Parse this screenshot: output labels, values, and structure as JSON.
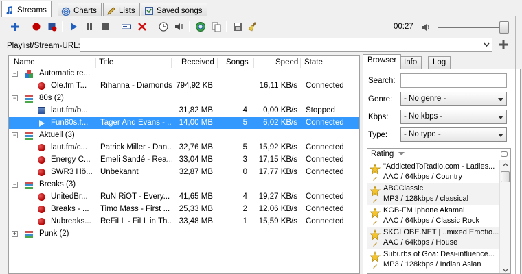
{
  "tabs": [
    {
      "label": "Streams",
      "icon": "note-icon"
    },
    {
      "label": "Charts",
      "icon": "broadcast-icon"
    },
    {
      "label": "Lists",
      "icon": "pencil-icon"
    },
    {
      "label": "Saved songs",
      "icon": "saved-icon"
    }
  ],
  "toolbar": {
    "time": "00:27"
  },
  "url": {
    "label": "Playlist/Stream-URL:",
    "value": ""
  },
  "columns": {
    "name": "Name",
    "title": "Title",
    "received": "Received",
    "songs": "Songs",
    "speed": "Speed",
    "state": "State"
  },
  "tree": {
    "groups": [
      {
        "name": "Automatic re...",
        "expanded": true,
        "streams": [
          {
            "name": "Ole.fm  T...",
            "title": "Rihanna - Diamonds",
            "received": "794,92 KB",
            "songs": "",
            "speed": "16,11 KB/s",
            "state": "Connected",
            "icon": "recording"
          }
        ]
      },
      {
        "name": "80s (2)",
        "expanded": true,
        "streams": [
          {
            "name": "laut.fm/b...",
            "title": "",
            "received": "31,82 MB",
            "songs": "4",
            "speed": "0,00 KB/s",
            "state": "Stopped",
            "icon": "stopped"
          },
          {
            "name": "Fun80s.f...",
            "title": "Tager And Evans - ...",
            "received": "14,00 MB",
            "songs": "5",
            "speed": "6,02 KB/s",
            "state": "Connected",
            "icon": "playing",
            "selected": true
          }
        ]
      },
      {
        "name": "Aktuell (3)",
        "expanded": true,
        "streams": [
          {
            "name": "laut.fm/c...",
            "title": "Patrick Miller - Dan...",
            "received": "32,76 MB",
            "songs": "5",
            "speed": "15,92 KB/s",
            "state": "Connected",
            "icon": "recording"
          },
          {
            "name": "Energy C...",
            "title": "Emeli Sandé - Rea...",
            "received": "33,04 MB",
            "songs": "3",
            "speed": "17,15 KB/s",
            "state": "Connected",
            "icon": "recording"
          },
          {
            "name": "SWR3 Hö...",
            "title": "Unbekannt",
            "received": "32,87 MB",
            "songs": "0",
            "speed": "17,77 KB/s",
            "state": "Connected",
            "icon": "recording"
          }
        ]
      },
      {
        "name": "Breaks (3)",
        "expanded": true,
        "streams": [
          {
            "name": "UnitedBr...",
            "title": "RuN RiOT - Every...",
            "received": "41,65 MB",
            "songs": "4",
            "speed": "19,27 KB/s",
            "state": "Connected",
            "icon": "recording"
          },
          {
            "name": "Breaks - ...",
            "title": "Timo Mass - First ...",
            "received": "25,33 MB",
            "songs": "2",
            "speed": "12,06 KB/s",
            "state": "Connected",
            "icon": "recording"
          },
          {
            "name": "Nubreaks...",
            "title": "ReFiLL - FiLL in Th...",
            "received": "33,48 MB",
            "songs": "1",
            "speed": "15,59 KB/s",
            "state": "Connected",
            "icon": "recording"
          }
        ]
      },
      {
        "name": "Punk (2)",
        "expanded": false,
        "streams": []
      }
    ]
  },
  "right_tabs": [
    "Browser",
    "Info",
    "Log"
  ],
  "browser": {
    "search_label": "Search:",
    "search_value": "",
    "genre_label": "Genre:",
    "genre_value": "- No genre -",
    "kbps_label": "Kbps:",
    "kbps_value": "- No kbps -",
    "type_label": "Type:",
    "type_value": "- No type -",
    "list_header": "Rating",
    "stations": [
      {
        "name": "\"AddictedToRadio.com - Ladies...",
        "info": "AAC / 64kbps / Country"
      },
      {
        "name": "ABCClassic",
        "info": "MP3 / 128kbps / classical"
      },
      {
        "name": "KGB-FM Iphone Akamai",
        "info": "AAC / 64kbps / Classic Rock"
      },
      {
        "name": "SKGLOBE.NET | ..mixed Emotio...",
        "info": "AAC / 64kbps / House"
      },
      {
        "name": "Suburbs of Goa: Desi-influence...",
        "info": "MP3 / 128kbps / Indian Asian"
      }
    ]
  },
  "colors": {
    "selection": "#3399ff",
    "record": "#c00000",
    "accent_blue": "#1f5fbf"
  }
}
